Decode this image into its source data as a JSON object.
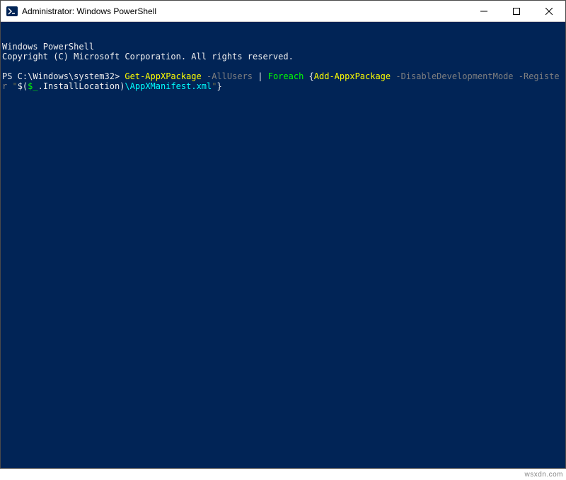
{
  "window": {
    "title": "Administrator: Windows PowerShell"
  },
  "terminal": {
    "line1": "Windows PowerShell",
    "line2": "Copyright (C) Microsoft Corporation. All rights reserved.",
    "prompt": "PS C:\\Windows\\system32> ",
    "cmd": {
      "getappx": "Get-AppXPackage",
      "allusers": " -AllUsers ",
      "pipe": "|",
      "space1": " ",
      "foreach": "Foreach",
      "space2": " ",
      "brace_open": "{",
      "addappx": "Add-AppxPackage",
      "flags": " -DisableDevelopmentMode -Register ",
      "quote1": "\"",
      "subexpr_open": "$(",
      "var": "$_",
      "prop": ".InstallLocation)",
      "path": "\\AppXManifest.xml",
      "quote2": "\"",
      "brace_close": "}"
    }
  },
  "watermark": "wsxdn.com"
}
